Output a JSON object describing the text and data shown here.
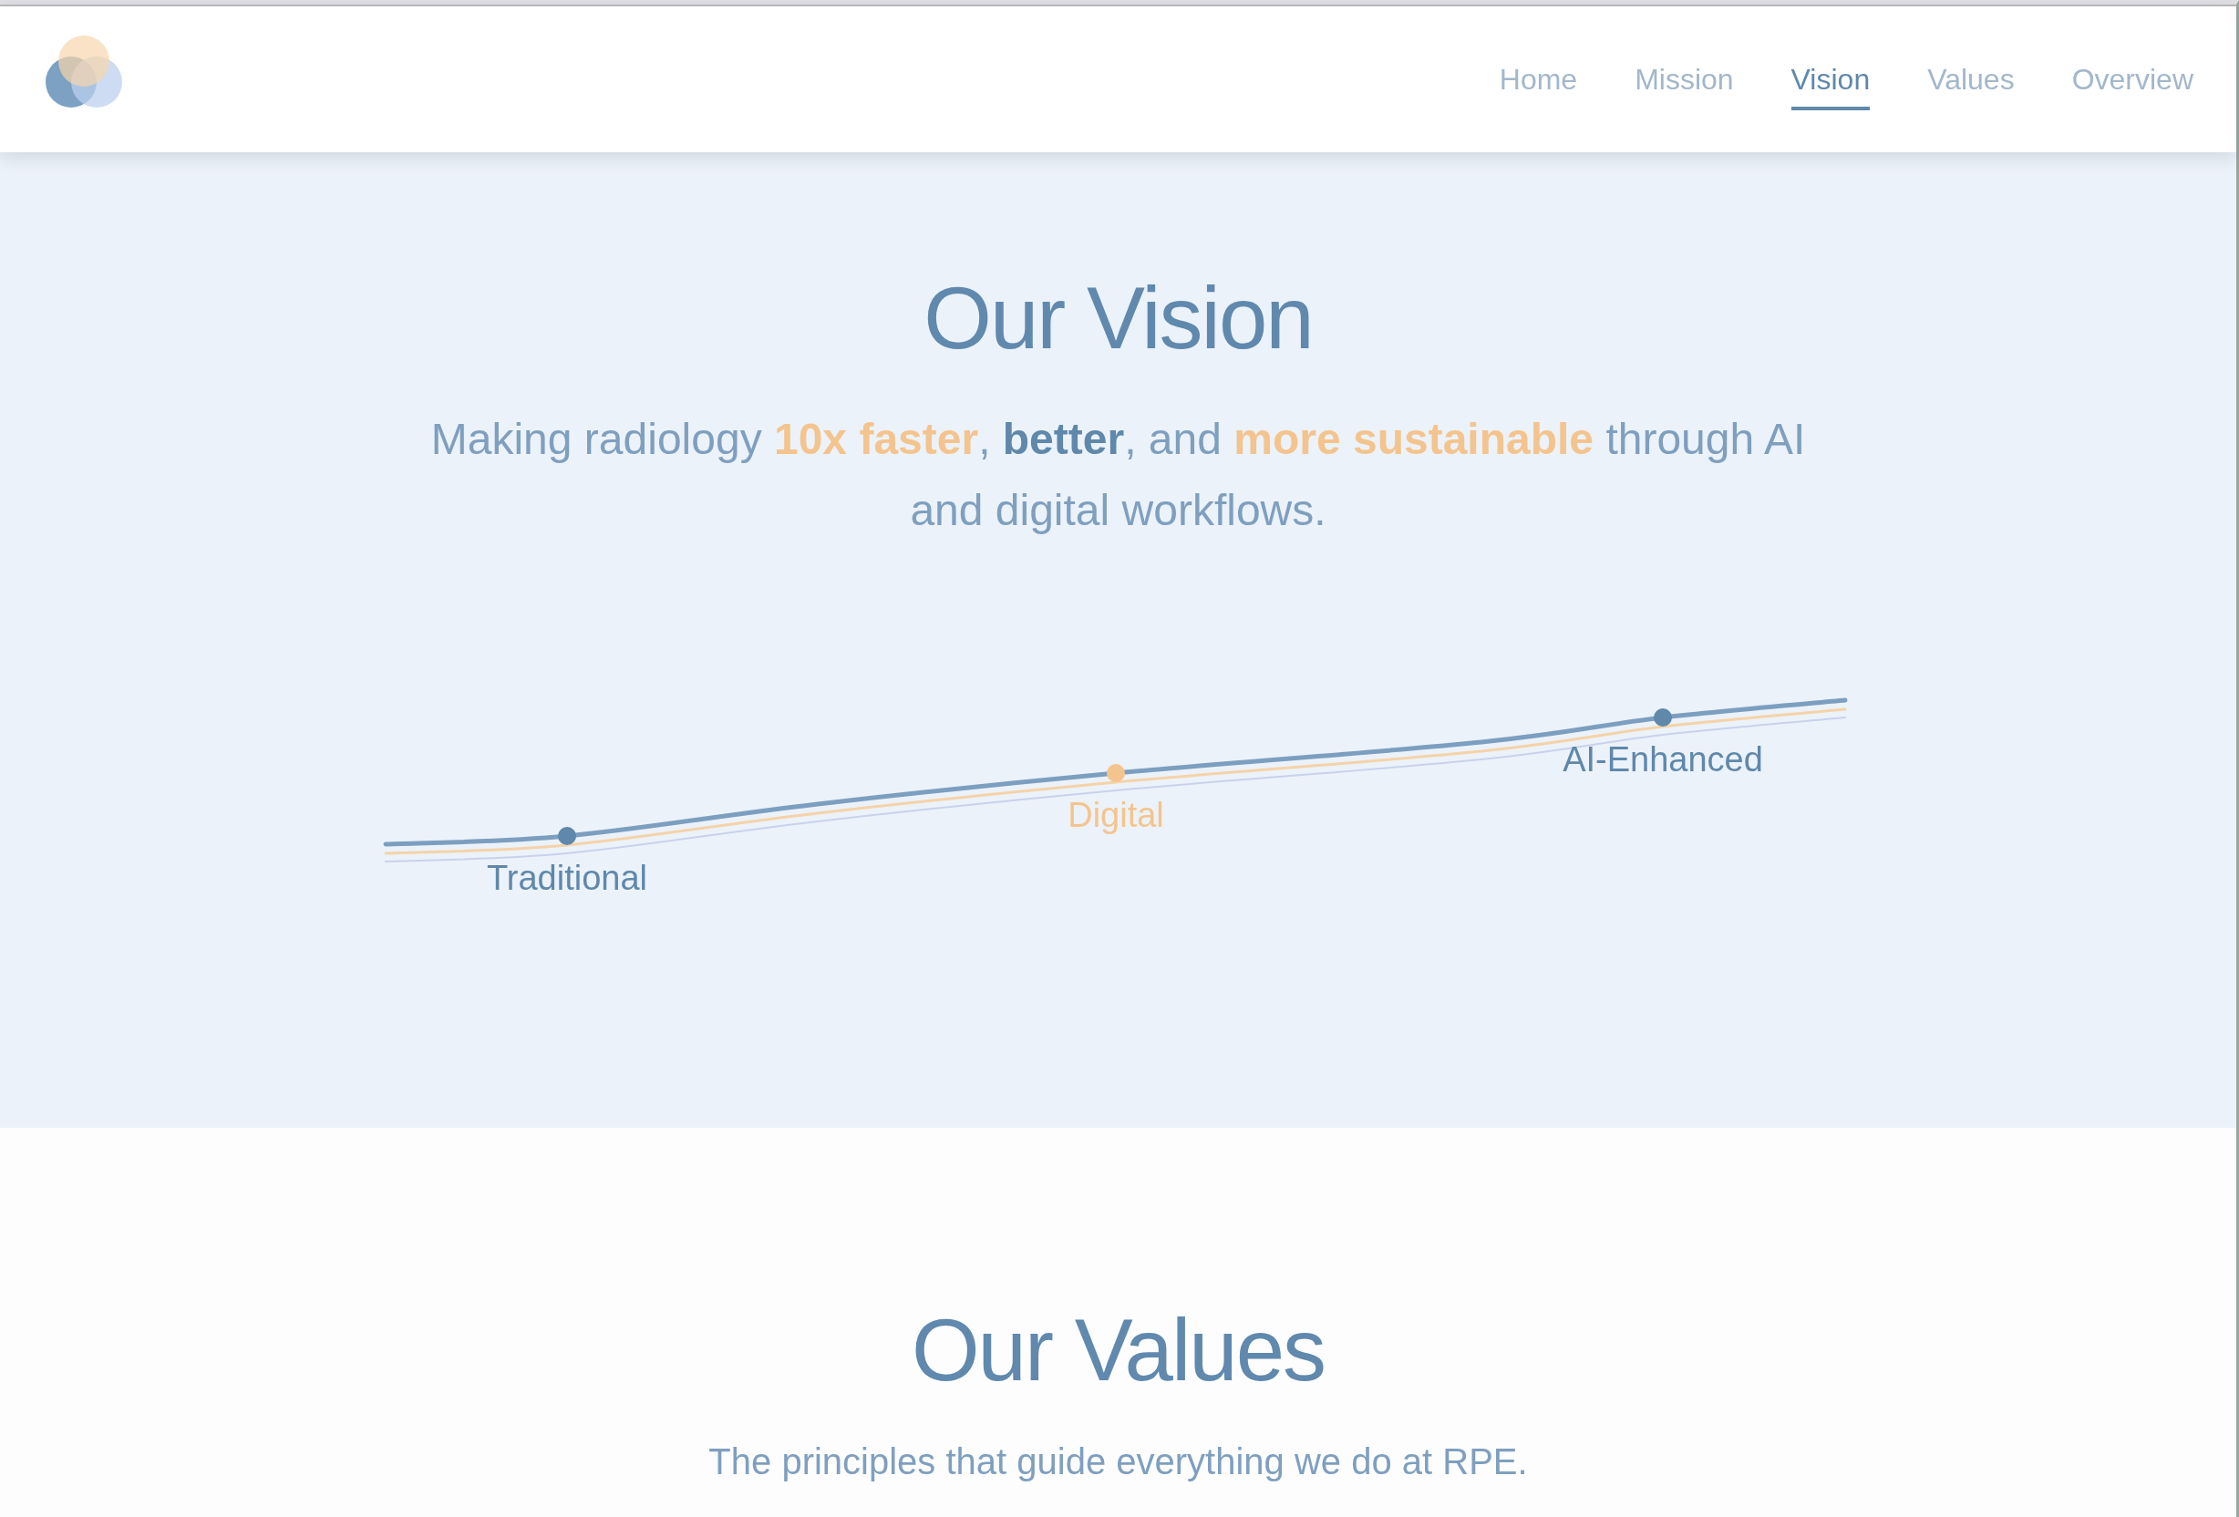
{
  "header": {
    "nav": [
      {
        "label": "Home",
        "selected": false
      },
      {
        "label": "Mission",
        "selected": false
      },
      {
        "label": "Vision",
        "selected": true
      },
      {
        "label": "Values",
        "selected": false
      },
      {
        "label": "Overview",
        "selected": false
      }
    ]
  },
  "vision": {
    "title": "Our Vision",
    "subtitle": [
      {
        "text": "Making radiology ",
        "kind": "plain"
      },
      {
        "text": "10x faster",
        "kind": "highlight"
      },
      {
        "text": ", ",
        "kind": "plain"
      },
      {
        "text": "better",
        "kind": "strong"
      },
      {
        "text": ", and ",
        "kind": "plain"
      },
      {
        "text": "more sustainable",
        "kind": "highlight"
      },
      {
        "text": " through AI and digital workflows.",
        "kind": "plain"
      }
    ],
    "timeline": {
      "milestones": [
        {
          "label": "Traditional",
          "color": "#5f88ab"
        },
        {
          "label": "Digital",
          "color": "#f4c48e"
        },
        {
          "label": "AI-Enhanced",
          "color": "#5f88ab"
        }
      ]
    }
  },
  "values": {
    "title": "Our Values",
    "subtitle": "The principles that guide everything we do at RPE."
  }
}
